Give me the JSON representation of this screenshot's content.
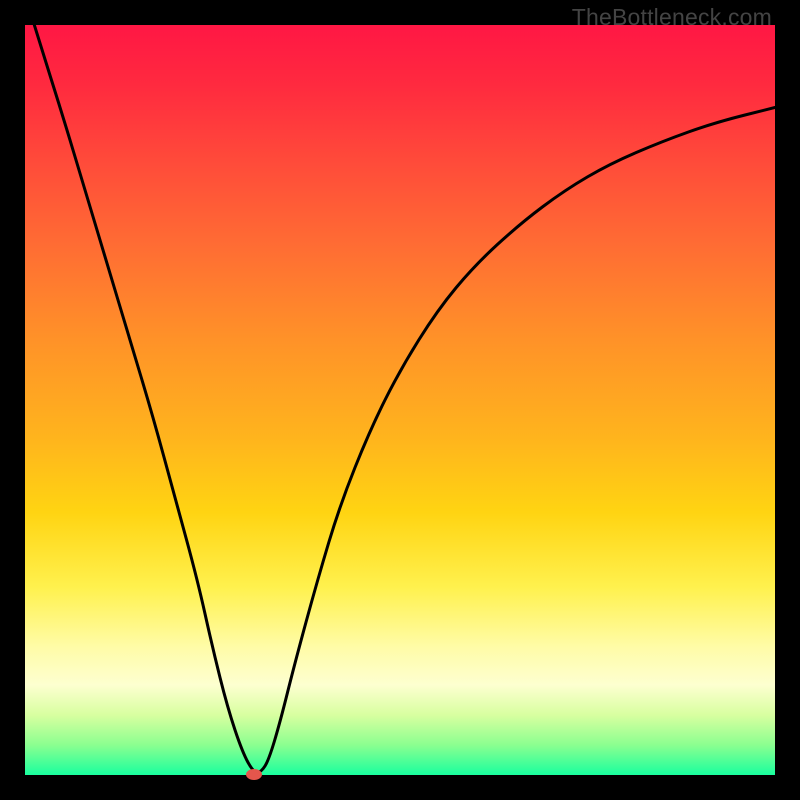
{
  "watermark": "TheBottleneck.com",
  "chart_data": {
    "type": "line",
    "title": "",
    "xlabel": "",
    "ylabel": "",
    "xlim": [
      0,
      1
    ],
    "ylim": [
      0,
      1
    ],
    "series": [
      {
        "name": "bottleneck-curve",
        "x": [
          0.0,
          0.02,
          0.05,
          0.08,
          0.11,
          0.14,
          0.17,
          0.2,
          0.23,
          0.25,
          0.27,
          0.29,
          0.305,
          0.315,
          0.325,
          0.34,
          0.36,
          0.39,
          0.42,
          0.46,
          0.5,
          0.55,
          0.6,
          0.66,
          0.72,
          0.78,
          0.85,
          0.92,
          1.0
        ],
        "y": [
          1.04,
          0.975,
          0.88,
          0.78,
          0.68,
          0.58,
          0.48,
          0.37,
          0.26,
          0.17,
          0.09,
          0.03,
          0.003,
          0.004,
          0.02,
          0.07,
          0.15,
          0.26,
          0.36,
          0.46,
          0.54,
          0.62,
          0.68,
          0.735,
          0.78,
          0.815,
          0.845,
          0.87,
          0.89
        ]
      }
    ],
    "marker": {
      "x": 0.305,
      "y": 0.002,
      "color": "#e5564c"
    },
    "gradient_stops": [
      {
        "pos": 0.0,
        "color": "#ff1744"
      },
      {
        "pos": 0.3,
        "color": "#ff6e33"
      },
      {
        "pos": 0.55,
        "color": "#ffb41d"
      },
      {
        "pos": 0.75,
        "color": "#fff14e"
      },
      {
        "pos": 0.92,
        "color": "#d8ffa0"
      },
      {
        "pos": 1.0,
        "color": "#19ff9e"
      }
    ]
  }
}
